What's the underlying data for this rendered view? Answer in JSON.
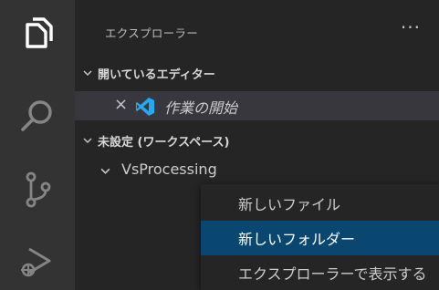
{
  "activity_bar": {
    "icons": [
      "explorer-icon",
      "search-icon",
      "source-control-icon",
      "run-debug-icon"
    ]
  },
  "sidebar": {
    "title": "エクスプローラー",
    "more_label": "···",
    "open_editors": {
      "label": "開いているエディター",
      "items": [
        {
          "label": "作業の開始",
          "close_label": "×",
          "icon": "vscode-logo-icon"
        }
      ]
    },
    "workspace": {
      "label": "未設定 (ワークスペース)",
      "folder_label": "VsProcessing"
    }
  },
  "context_menu": {
    "items": [
      {
        "label": "新しいファイル",
        "selected": false
      },
      {
        "label": "新しいフォルダー",
        "selected": true
      },
      {
        "label": "エクスプローラーで表示する",
        "selected": false
      }
    ]
  },
  "colors": {
    "activity_bar": "#333333",
    "sidebar": "#252526",
    "selection": "#094771",
    "row_highlight": "#37373d",
    "vscode_blue": "#23a9f2"
  }
}
